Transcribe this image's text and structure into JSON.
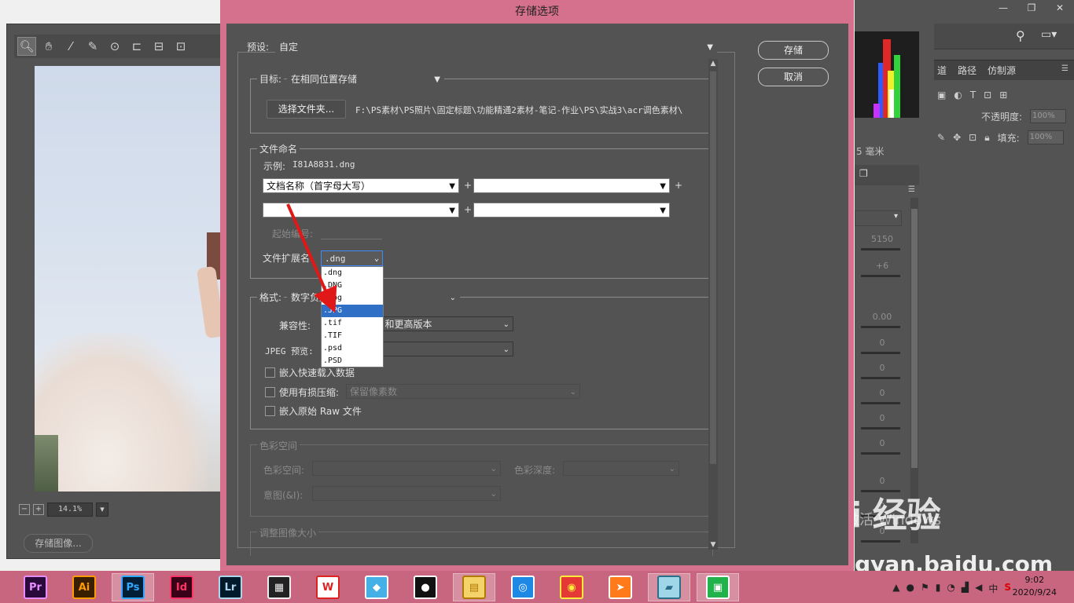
{
  "dialog": {
    "title": "存储选项",
    "preset_label": "预设:",
    "preset_value": "自定",
    "save_button": "存储",
    "cancel_button": "取消",
    "destination": {
      "label": "目标:",
      "value": "在相同位置存储",
      "select_folder_button": "选择文件夹...",
      "path": "F:\\PS素材\\PS照片\\固定标题\\功能精通2素材-笔记-作业\\PS\\实战3\\acr调色素材\\"
    },
    "file_naming": {
      "title": "文件命名",
      "example_label": "示例:",
      "example_value": "I81A8831.dng",
      "name_field_1": "文档名称（首字母大写）",
      "name_field_2": "",
      "name_field_3": "",
      "name_field_4": "",
      "plus": "+",
      "start_number_label": "起始编号:",
      "extension_label": "文件扩展名:",
      "extension_value": ".dng",
      "extension_options": [
        ".dng",
        ".DNG",
        ".jpg",
        ".JPG",
        ".tif",
        ".TIF",
        ".psd",
        ".PSD"
      ],
      "extension_selected": ".JPG"
    },
    "format": {
      "title": "格式:",
      "value": "数字负片",
      "compat_label": "兼容性:",
      "compat_value": "1 和更高版本",
      "jpeg_preview_label": "JPEG 预览:",
      "embed_fast_load": "嵌入快速载入数据",
      "use_lossy": "使用有损压缩:",
      "lossy_value": "保留像素数",
      "embed_raw": "嵌入原始 Raw 文件"
    },
    "color_space": {
      "title": "色彩空间",
      "space_label": "色彩空间:",
      "depth_label": "色彩深度:",
      "intent_label": "意图(&I):"
    },
    "resize": {
      "title": "调整图像大小"
    }
  },
  "background": {
    "zoom_value": "14.1%",
    "save_image_button": "存储图像...",
    "histogram_unit": "5 毫米",
    "panel_tabs": [
      "道",
      "路径",
      "仿制源"
    ],
    "opacity_label": "不透明度:",
    "opacity_value": "100%",
    "fill_label": "填充:",
    "fill_value": "100%",
    "slider_values": [
      "5150",
      "+6",
      "0.00",
      "0",
      "0",
      "0",
      "0",
      "0",
      "0",
      "0",
      "0"
    ],
    "watermark_brand": "Bai 经验",
    "watermark_url": "jingyan.baidu.com",
    "watermark_activate": "激活 Windows"
  },
  "taskbar": {
    "apps": [
      {
        "name": "premiere",
        "label": "Pr",
        "bg": "#2a0a3a",
        "fg": "#e78cff"
      },
      {
        "name": "illustrator",
        "label": "Ai",
        "bg": "#3a1e00",
        "fg": "#ff9a00"
      },
      {
        "name": "photoshop",
        "label": "Ps",
        "bg": "#001e36",
        "fg": "#31a8ff"
      },
      {
        "name": "indesign",
        "label": "Id",
        "bg": "#3a0018",
        "fg": "#ff3366"
      },
      {
        "name": "lightroom",
        "label": "Lr",
        "bg": "#001a2b",
        "fg": "#add5ec"
      },
      {
        "name": "video-editor",
        "label": "▦",
        "bg": "#222",
        "fg": "#eee"
      },
      {
        "name": "wps",
        "label": "W",
        "bg": "#fff",
        "fg": "#d22"
      },
      {
        "name": "bird-app",
        "label": "◆",
        "bg": "#45b0e6",
        "fg": "#fff"
      },
      {
        "name": "qq",
        "label": "●",
        "bg": "#111",
        "fg": "#fff"
      },
      {
        "name": "file-explorer",
        "label": "▤",
        "bg": "#f5d36b",
        "fg": "#b07a00"
      },
      {
        "name": "browser-q",
        "label": "◎",
        "bg": "#1e88e5",
        "fg": "#fff"
      },
      {
        "name": "chrome",
        "label": "◉",
        "bg": "#e53935",
        "fg": "#ffeb3b"
      },
      {
        "name": "thunder",
        "label": "➤",
        "bg": "#ff7a1a",
        "fg": "#fff"
      },
      {
        "name": "notes",
        "label": "▰",
        "bg": "#9fd6e8",
        "fg": "#2a6f8a"
      },
      {
        "name": "green-app",
        "label": "▣",
        "bg": "#21b24b",
        "fg": "#fff"
      }
    ],
    "tray_ime": "中",
    "time": "9:02",
    "date": "2020/9/24"
  }
}
